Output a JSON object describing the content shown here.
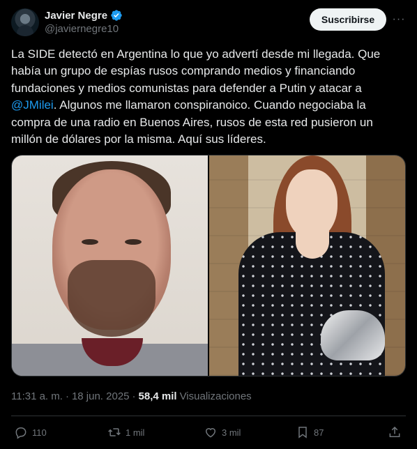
{
  "author": {
    "display_name": "Javier Negre",
    "handle": "@javiernegre10"
  },
  "follow_label": "Suscribirse",
  "more_label": "···",
  "tweet": {
    "text_before": "La SIDE detectó en Argentina lo que yo advertí desde mi llegada. Que había un grupo de espías rusos comprando medios y financiando fundaciones y medios comunistas para defender a Putin y atacar a ",
    "mention": "@JMilei",
    "text_after": ". Algunos me llamaron conspiranoico. Cuando negociaba la compra de una radio en Buenos Aires, rusos de esta red pusieron un millón de dólares por la misma. Aquí sus líderes."
  },
  "meta": {
    "time": "11:31 a. m.",
    "date": "18 jun. 2025",
    "separator": "·",
    "views_count": "58,4 mil",
    "views_label": "Visualizaciones"
  },
  "actions": {
    "replies": "110",
    "reposts": "1 mil",
    "likes": "3 mil",
    "bookmarks": "87"
  },
  "colors": {
    "background": "#000000",
    "text": "#e7e9ea",
    "secondary": "#71767b",
    "accent": "#1d9bf0",
    "verified": "#1d9bf0"
  },
  "icons": [
    "verified-badge-icon",
    "more-icon",
    "reply-icon",
    "repost-icon",
    "like-icon",
    "bookmark-icon",
    "share-icon"
  ]
}
